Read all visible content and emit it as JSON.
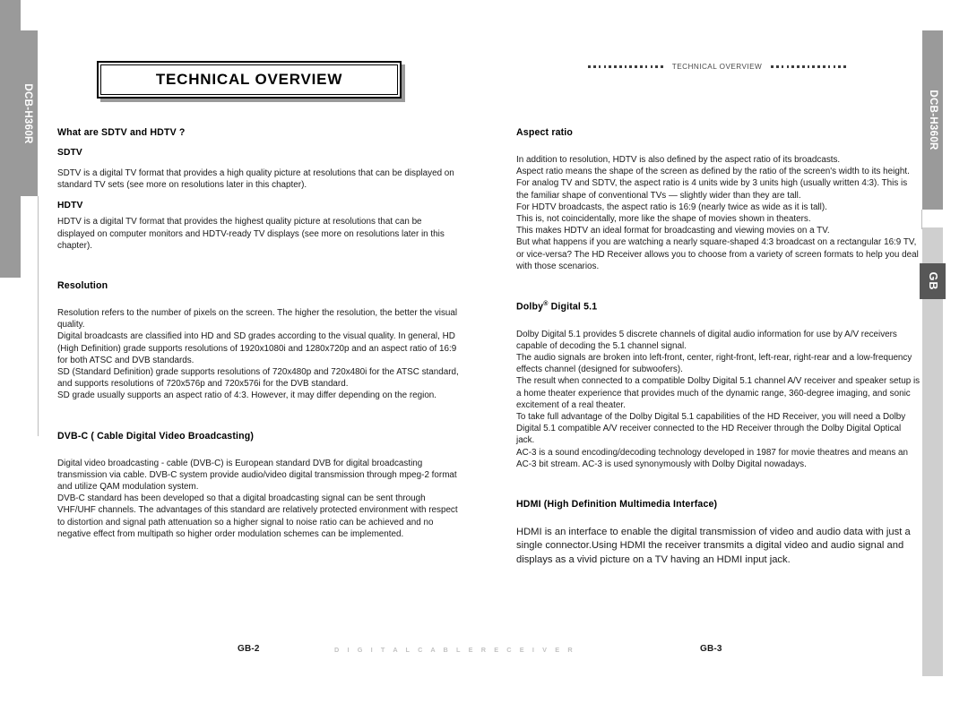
{
  "document": {
    "model_tab_label": "DCB-H360R",
    "language_tab_label": "GB"
  },
  "left_page": {
    "title": "TECHNICAL OVERVIEW",
    "sections": [
      {
        "heading": "What are SDTV and HDTV ?",
        "sub_heading_1": "SDTV",
        "body_1": "SDTV is a digital TV format that provides a high quality picture at resolutions that can be displayed on standard TV sets (see more on resolutions later in this chapter).",
        "sub_heading_2": "HDTV",
        "body_2": "HDTV is a digital TV format that provides the highest quality picture at resolutions that can be displayed on computer monitors and HDTV-ready TV displays (see more on resolutions later in this chapter)."
      },
      {
        "heading": "Resolution",
        "body_1": "Resolution refers to the number of pixels on the screen. The higher the resolution, the better the visual quality.",
        "body_2": "Digital broadcasts are classified into HD and SD grades according to the visual quality. In general, HD (High Definition) grade supports resolutions of 1920x1080i and 1280x720p and an aspect ratio of 16:9 for both ATSC and DVB standards.",
        "body_3": "SD (Standard Definition) grade supports resolutions of 720x480p and 720x480i for the ATSC standard, and supports resolutions of 720x576p and 720x576i for the DVB standard.",
        "body_4": "SD grade usually supports an aspect ratio of 4:3. However, it may differ depending on the region."
      },
      {
        "heading": "DVB-C ( Cable Digital Video Broadcasting)",
        "body_1": "Digital video broadcasting - cable (DVB-C) is European standard DVB for digital broadcasting transmission via cable. DVB-C system provide audio/video digital  transmission through mpeg-2 format and utilize QAM modulation system.",
        "body_2": "DVB-C standard has been developed so that a digital broadcasting signal can be sent through VHF/UHF  channels. The advantages of this standard are relatively protected environment with respect to distortion and signal path attenuation so a higher signal to noise ratio can be achieved and no negative effect from multipath so higher order modulation schemes can be implemented."
      }
    ],
    "page_number": "GB-2"
  },
  "right_page": {
    "running_header": "TECHNICAL OVERVIEW",
    "sections": [
      {
        "heading": "Aspect ratio",
        "body_1": "In addition to resolution, HDTV is also defined by the aspect ratio of its broadcasts.",
        "body_2": "Aspect ratio means the shape of the screen as defined by the ratio of the screen's width to its height. For analog TV and SDTV, the aspect ratio is 4 units wide by 3 units high (usually written 4:3). This is the familiar shape of conventional TVs — slightly wider than they are tall.",
        "body_3": "For HDTV broadcasts, the aspect ratio is 16:9 (nearly twice as wide as it is tall).",
        "body_4": "This is, not coincidentally, more like the shape of movies shown in theaters.",
        "body_5": "This makes HDTV an ideal format for broadcasting and viewing movies on a TV.",
        "body_6": "But what happens if you are watching a nearly square-shaped 4:3 broadcast on a rectangular 16:9 TV, or vice-versa? The HD Receiver allows you to choose from a variety of screen formats to help you deal with those scenarios."
      },
      {
        "heading_prefix": "Dolby",
        "heading_sup": "®",
        "heading_suffix": " Digital 5.1",
        "body_1": "Dolby Digital 5.1 provides 5 discrete channels of digital audio information for use by A/V receivers capable of decoding the 5.1 channel signal.",
        "body_2": "The audio signals are broken into left-front, center, right-front, left-rear, right-rear and a low-frequency effects channel (designed for subwoofers).",
        "body_3": "The result when connected to a compatible Dolby Digital 5.1 channel A/V receiver and speaker setup is a home theater experience that provides much of the dynamic range, 360-degree imaging, and sonic excitement of a real theater.",
        "body_4": "To take full advantage of the Dolby Digital 5.1 capabilities of the HD Receiver, you will need a Dolby Digital 5.1 compatible A/V receiver connected to the HD Receiver through the Dolby Digital Optical jack.",
        "body_5": "AC-3 is a sound encoding/decoding technology developed in 1987 for movie theatres and means an AC-3 bit stream. AC-3 is used synonymously with Dolby Digital nowadays."
      },
      {
        "heading": "HDMI (High Definition Multimedia Interface)",
        "body_1": "HDMI is an interface to enable the digital transmission of video and audio data with just a single connector.Using HDMI  the receiver transmits a digital video and audio signal and displays as a vivid picture on a TV having an HDMI input jack."
      }
    ],
    "page_number": "GB-3"
  },
  "footer": {
    "brand_line": "D I G I T A L   C A B L E   R E C E I V E R"
  },
  "colors": {
    "tab_gray": "#9a9a9a",
    "strip_light_gray": "#cfcfcf",
    "tab_dark": "#575757",
    "footer_gray": "#c2c2c2"
  }
}
